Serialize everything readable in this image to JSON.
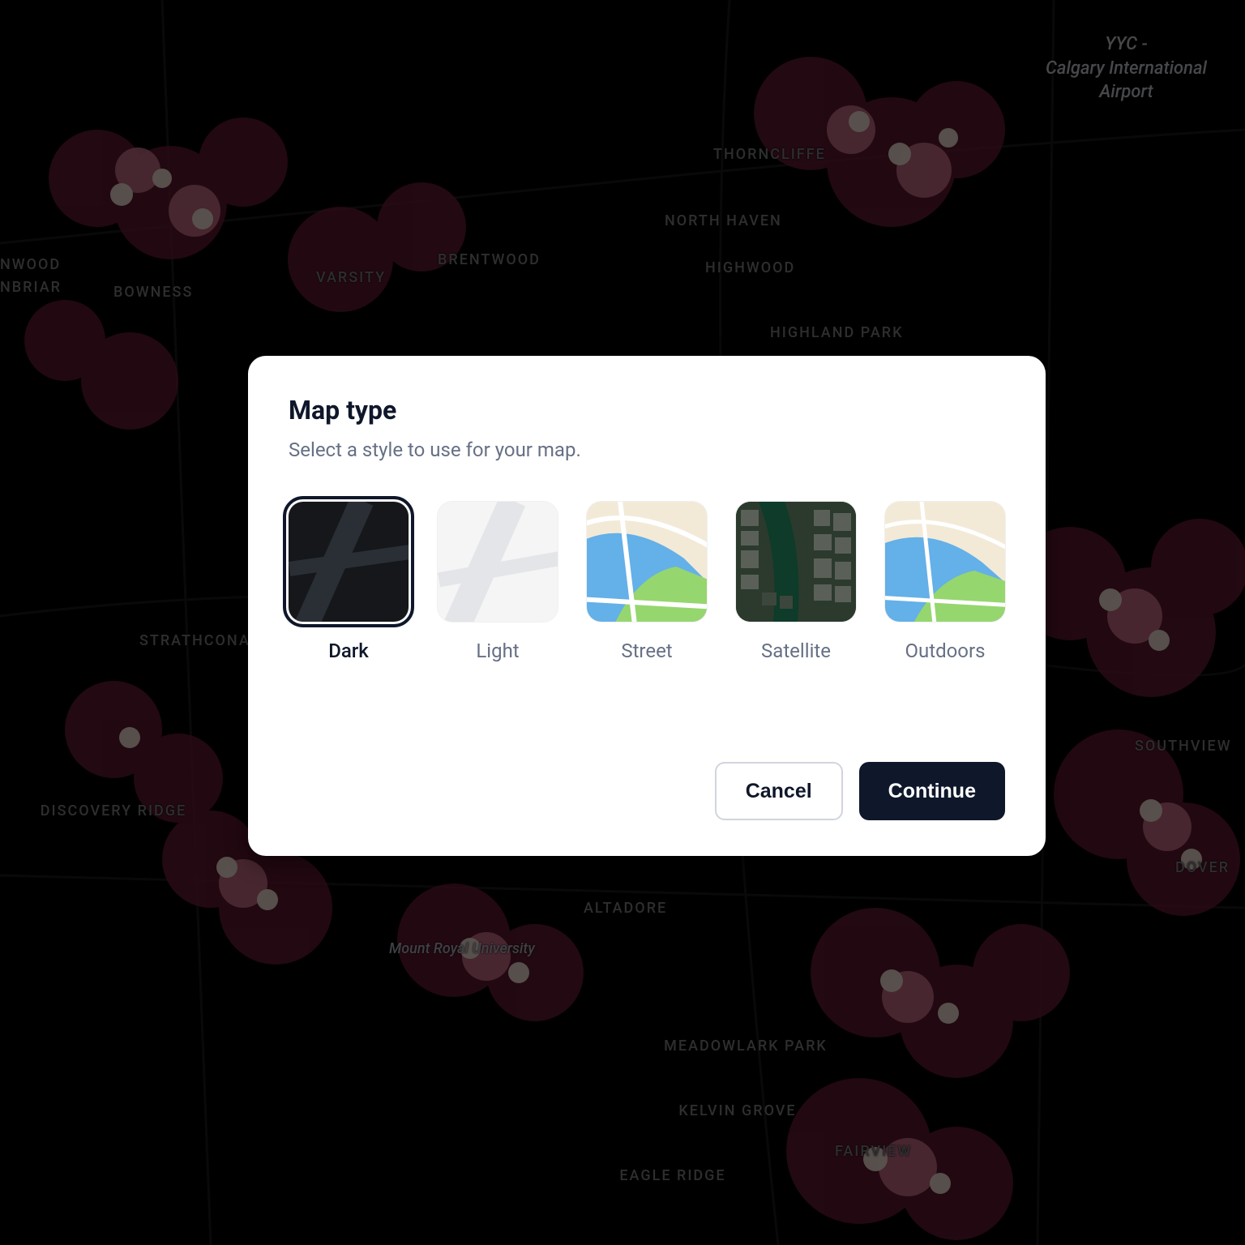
{
  "modal": {
    "title": "Map type",
    "subtitle": "Select a style to use for your map.",
    "options": [
      {
        "label": "Dark",
        "selected": true
      },
      {
        "label": "Light",
        "selected": false
      },
      {
        "label": "Street",
        "selected": false
      },
      {
        "label": "Satellite",
        "selected": false
      },
      {
        "label": "Outdoors",
        "selected": false
      }
    ],
    "cancel_label": "Cancel",
    "continue_label": "Continue"
  },
  "background_map": {
    "airport_label": "YYC -\nCalgary International\nAirport",
    "neighborhoods": [
      "THORNCLIFFE",
      "NORTH HAVEN",
      "HIGHWOOD",
      "HIGHLAND PARK",
      "BRENTWOOD",
      "VARSITY",
      "BOWNESS",
      "NWOOD",
      "NBRIAR",
      "STRATHCONA PARK",
      "DISCOVERY RIDGE",
      "ALTADORE",
      "MEADOWLARK PARK",
      "KELVIN GROVE",
      "EAGLE RIDGE",
      "FAIRVIEW",
      "DOVER",
      "SOUTHVIEW"
    ],
    "poi": [
      "Mount Royal University"
    ]
  }
}
